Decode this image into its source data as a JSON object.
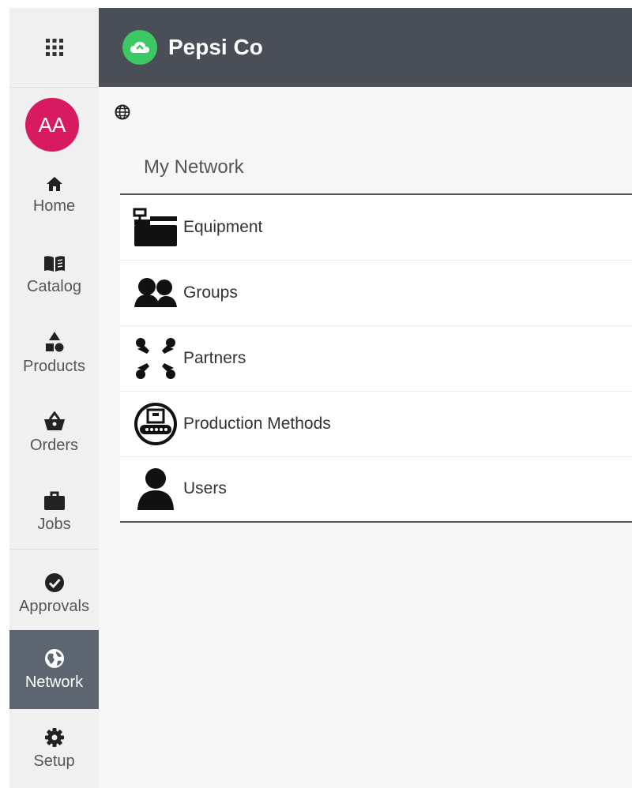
{
  "header": {
    "brand_name": "Pepsi Co"
  },
  "user": {
    "initials": "AA"
  },
  "sidebar": {
    "items": [
      {
        "label": "Home",
        "icon": "home-icon"
      },
      {
        "label": "Catalog",
        "icon": "book-icon"
      },
      {
        "label": "Products",
        "icon": "shapes-icon"
      },
      {
        "label": "Orders",
        "icon": "basket-icon"
      },
      {
        "label": "Jobs",
        "icon": "briefcase-icon"
      },
      {
        "label": "Approvals",
        "icon": "check-circle-icon"
      },
      {
        "label": "Network",
        "icon": "globe-icon",
        "active": true
      },
      {
        "label": "Setup",
        "icon": "gear-icon"
      }
    ]
  },
  "main": {
    "panel_title": "My Network",
    "rows": [
      {
        "label": "Equipment",
        "icon": "equipment-icon"
      },
      {
        "label": "Groups",
        "icon": "groups-icon"
      },
      {
        "label": "Partners",
        "icon": "partners-icon"
      },
      {
        "label": "Production Methods",
        "icon": "production-methods-icon"
      },
      {
        "label": "Users",
        "icon": "user-icon"
      }
    ]
  },
  "colors": {
    "header_bg": "#4a4f57",
    "sidebar_bg": "#f0f0f0",
    "active_nav_bg": "#5d6670",
    "avatar_bg": "#d81b60",
    "brand_logo": "#3cc862"
  }
}
